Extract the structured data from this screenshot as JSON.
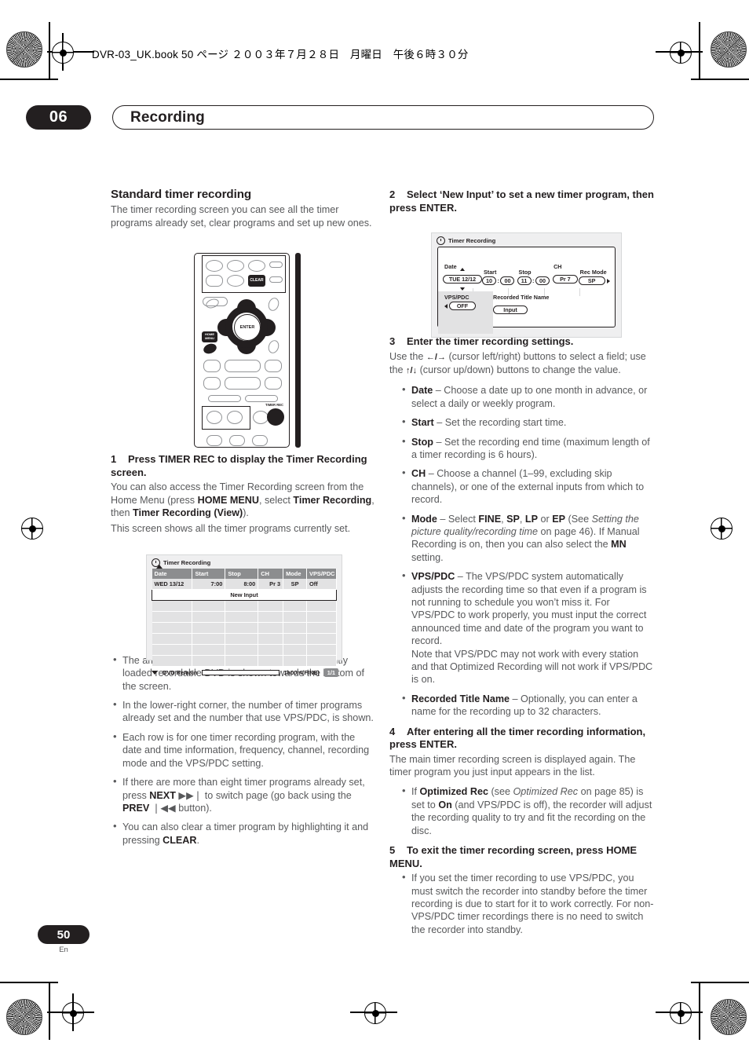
{
  "book_header": "DVR-03_UK.book 50 ページ ２００３年７月２８日　月曜日　午後６時３０分",
  "chapter": {
    "number": "06",
    "title": "Recording"
  },
  "footer": {
    "page_number": "50",
    "language": "En"
  },
  "left_column": {
    "section_title": "Standard timer recording",
    "intro": "The timer recording screen you can see all the timer programs already set, clear programs and set up new ones.",
    "remote": {
      "clear_label": "CLEAR",
      "enter_label": "ENTER",
      "home_menu_label": "HOME MENU",
      "timer_rec_label": "TIMER REC"
    },
    "step1": {
      "number": "1",
      "heading": "Press TIMER REC to display the Timer Recording screen.",
      "body_1_a": "You can also access the Timer Recording screen from the Home Menu (press ",
      "body_1_b": "HOME MENU",
      "body_1_c": ", select ",
      "body_1_d": "Timer Recording",
      "body_1_e": ", then ",
      "body_1_f": "Timer Recording (View)",
      "body_1_g": ").",
      "body_2": "This screen shows all the timer programs currently set."
    },
    "timer_list_screen": {
      "title": "Timer Recording",
      "columns": [
        "Date",
        "Start",
        "Stop",
        "CH",
        "Mode",
        "VPS/PDC"
      ],
      "rows": [
        [
          "WED 13/12",
          "7:00",
          "8:00",
          "Pr 3",
          "SP",
          "Off"
        ]
      ],
      "new_input_label": "New Input",
      "empty_row_count": 6,
      "dvd_remain_label": "DVD Remain",
      "dvd_remain_value": "1h00m(FINE)",
      "page_indicator": "1/1"
    },
    "bullets": [
      "The amount of free space available on the currently loaded recordable DVD is shown towards the bottom of the screen.",
      "In the lower-right corner, the number of timer programs already set and the number that use VPS/PDC, is shown.",
      "Each row is for one timer recording program, with the date and time information, frequency, channel, recording mode and the VPS/PDC setting."
    ],
    "bullet_next": {
      "a": "If there are more than eight timer programs already set, press ",
      "b": "NEXT",
      "c": " ▶▶❘ to switch page (go back using the ",
      "d": "PREV",
      "e": " ❘◀◀ button)."
    },
    "bullet_clear": {
      "a": "You can also clear a timer program by highlighting it and pressing ",
      "b": "CLEAR",
      "c": "."
    }
  },
  "right_column": {
    "step2": {
      "number": "2",
      "heading": "Select ‘New Input’ to set a new timer program, then press ENTER."
    },
    "timer_edit_screen": {
      "title": "Timer Recording",
      "fields": {
        "date_label": "Date",
        "date_value": "TUE 12/12",
        "start_label": "Start",
        "start_hour": "10",
        "start_minute": "00",
        "stop_label": "Stop",
        "stop_hour": "11",
        "stop_minute": "00",
        "ch_label": "CH",
        "ch_value": "Pr 7",
        "rec_mode_label": "Rec Mode",
        "rec_mode_value": "SP",
        "vps_pdc_label": "VPS/PDC",
        "vps_pdc_value": "OFF",
        "title_name_label": "Recorded Title Name",
        "title_name_value": "Input"
      },
      "time_separator": ":"
    },
    "step3": {
      "number": "3",
      "heading": "Enter the timer recording settings.",
      "body_a": "Use the ",
      "body_b": "←/→",
      "body_c": " (cursor left/right) buttons to select a field; use the ",
      "body_d": "↑/↓",
      "body_e": " (cursor up/down) buttons to change the value."
    },
    "settings": [
      {
        "term": "Date",
        "text": " – Choose a date up to one month in advance, or select a daily or weekly program."
      },
      {
        "term": "Start",
        "text": " – Set the recording start time."
      },
      {
        "term": "Stop",
        "text": " – Set the recording end time (maximum length of a timer recording is 6 hours)."
      },
      {
        "term": "CH",
        "text": " – Choose a channel (1–99, excluding skip channels), or one of the external inputs from which to record."
      }
    ],
    "mode_bullet": {
      "term": "Mode",
      "a": " – Select ",
      "b": "FINE",
      "c": ", ",
      "d": "SP",
      "e": ", ",
      "f": "LP",
      "g": " or ",
      "h": "EP",
      "i": " (See ",
      "j": "Setting the picture quality/recording time",
      "k": " on page 46). If Manual Recording is on, then you can also select the ",
      "l": "MN",
      "m": " setting."
    },
    "vps_bullet": {
      "term": "VPS/PDC",
      "a": " – The VPS/PDC system automatically adjusts the recording time so that even if a program is not running to schedule you won’t miss it. For VPS/PDC to work properly, you must input the correct announced time and date of the program you want to record.",
      "b": "Note that VPS/PDC may not work with every station and that Optimized Recording will not work if VPS/PDC is on."
    },
    "title_name_bullet": {
      "term": "Recorded Title Name",
      "text": " – Optionally, you can enter a name for the recording up to 32 characters."
    },
    "step4": {
      "number": "4",
      "heading": "After entering all the timer recording information, press ENTER.",
      "body": "The main timer recording screen is displayed again. The timer program you just input appears in the list.",
      "bullet": {
        "a": "If ",
        "b": "Optimized Rec",
        "c": " (see ",
        "d": "Optimized Rec",
        "e": " on page 85) is set to ",
        "f": "On",
        "g": " (and VPS/PDC is off), the recorder will adjust the recording quality to try and fit the recording on the disc."
      }
    },
    "step5": {
      "number": "5",
      "heading": "To exit the timer recording screen, press HOME MENU.",
      "bullet": "If you set the timer recording to use VPS/PDC, you must switch the recorder into standby before the timer recording is due to start for it to work correctly. For non-VPS/PDC timer recordings there is no need to switch the recorder into standby."
    }
  }
}
